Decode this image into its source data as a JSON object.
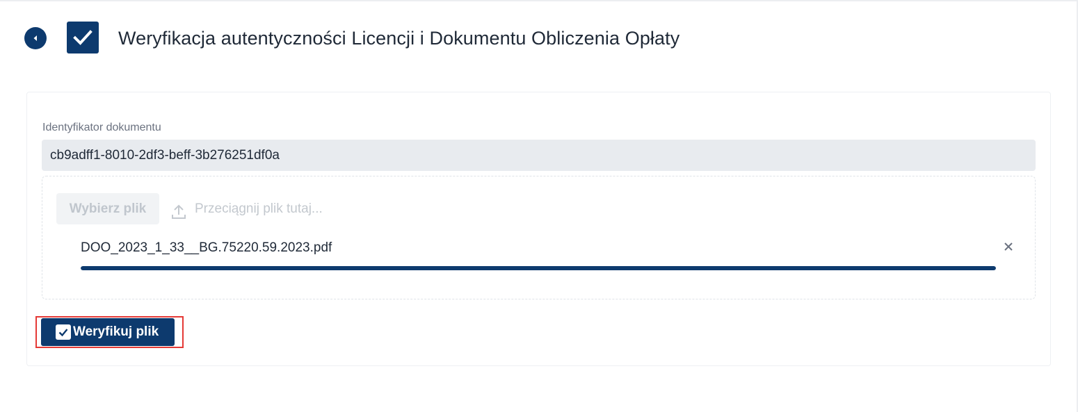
{
  "header": {
    "back_icon": "back-arrow-circle-icon",
    "header_icon": "checkbox-checked-icon",
    "title": "Weryfikacja autentyczności Licencji i Dokumentu Obliczenia Opłaty"
  },
  "form": {
    "document_id_label": "Identyfikator dokumentu",
    "document_id_value": "cb9adff1-8010-2df3-beff-3b276251df0a"
  },
  "upload": {
    "choose_button_label": "Wybierz plik",
    "upload_icon": "upload-icon",
    "drop_hint": "Przeciągnij plik tutaj...",
    "file_name": "DOO_2023_1_33__BG.75220.59.2023.pdf",
    "remove_icon": "close-icon",
    "progress_fraction": 1.0
  },
  "actions": {
    "verify_label": "Weryfikuj plik",
    "verify_icon": "checkbox-checked-icon"
  },
  "colors": {
    "primary": "#0d3a6e",
    "highlight": "#e53935"
  }
}
